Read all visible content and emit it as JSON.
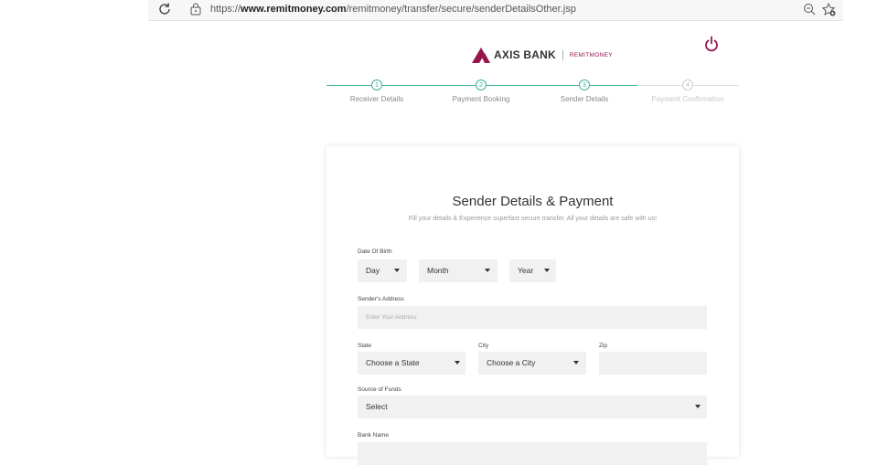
{
  "browser": {
    "url_prefix": "https://",
    "url_domain": "www.remitmoney.com",
    "url_path": "/remitmoney/transfer/secure/senderDetailsOther.jsp"
  },
  "header": {
    "bank_name": "AXIS BANK",
    "product_name": "REMITMONEY"
  },
  "stepper": {
    "steps": [
      {
        "number": "1",
        "label": "Receiver Details"
      },
      {
        "number": "2",
        "label": "Payment Booking"
      },
      {
        "number": "3",
        "label": "Sender Details"
      },
      {
        "number": "4",
        "label": "Payment Confirmation"
      }
    ],
    "active_color": "#3cb29a",
    "inactive_color": "#cccccc"
  },
  "form": {
    "title": "Sender Details & Payment",
    "subtitle": "Fill your details & Experience superfast secure transfer. All your details are safe with us!",
    "dob": {
      "label": "Date Of Birth",
      "day": "Day",
      "month": "Month",
      "year": "Year"
    },
    "address": {
      "label": "Sender's Address",
      "placeholder": "Enter Your Address"
    },
    "state": {
      "label": "State",
      "value": "Choose a State"
    },
    "city": {
      "label": "City",
      "value": "Choose a City"
    },
    "zip": {
      "label": "Zip",
      "value": ""
    },
    "source_of_funds": {
      "label": "Source of Funds",
      "value": "Select"
    },
    "bank_name": {
      "label": "Bank Name"
    }
  }
}
